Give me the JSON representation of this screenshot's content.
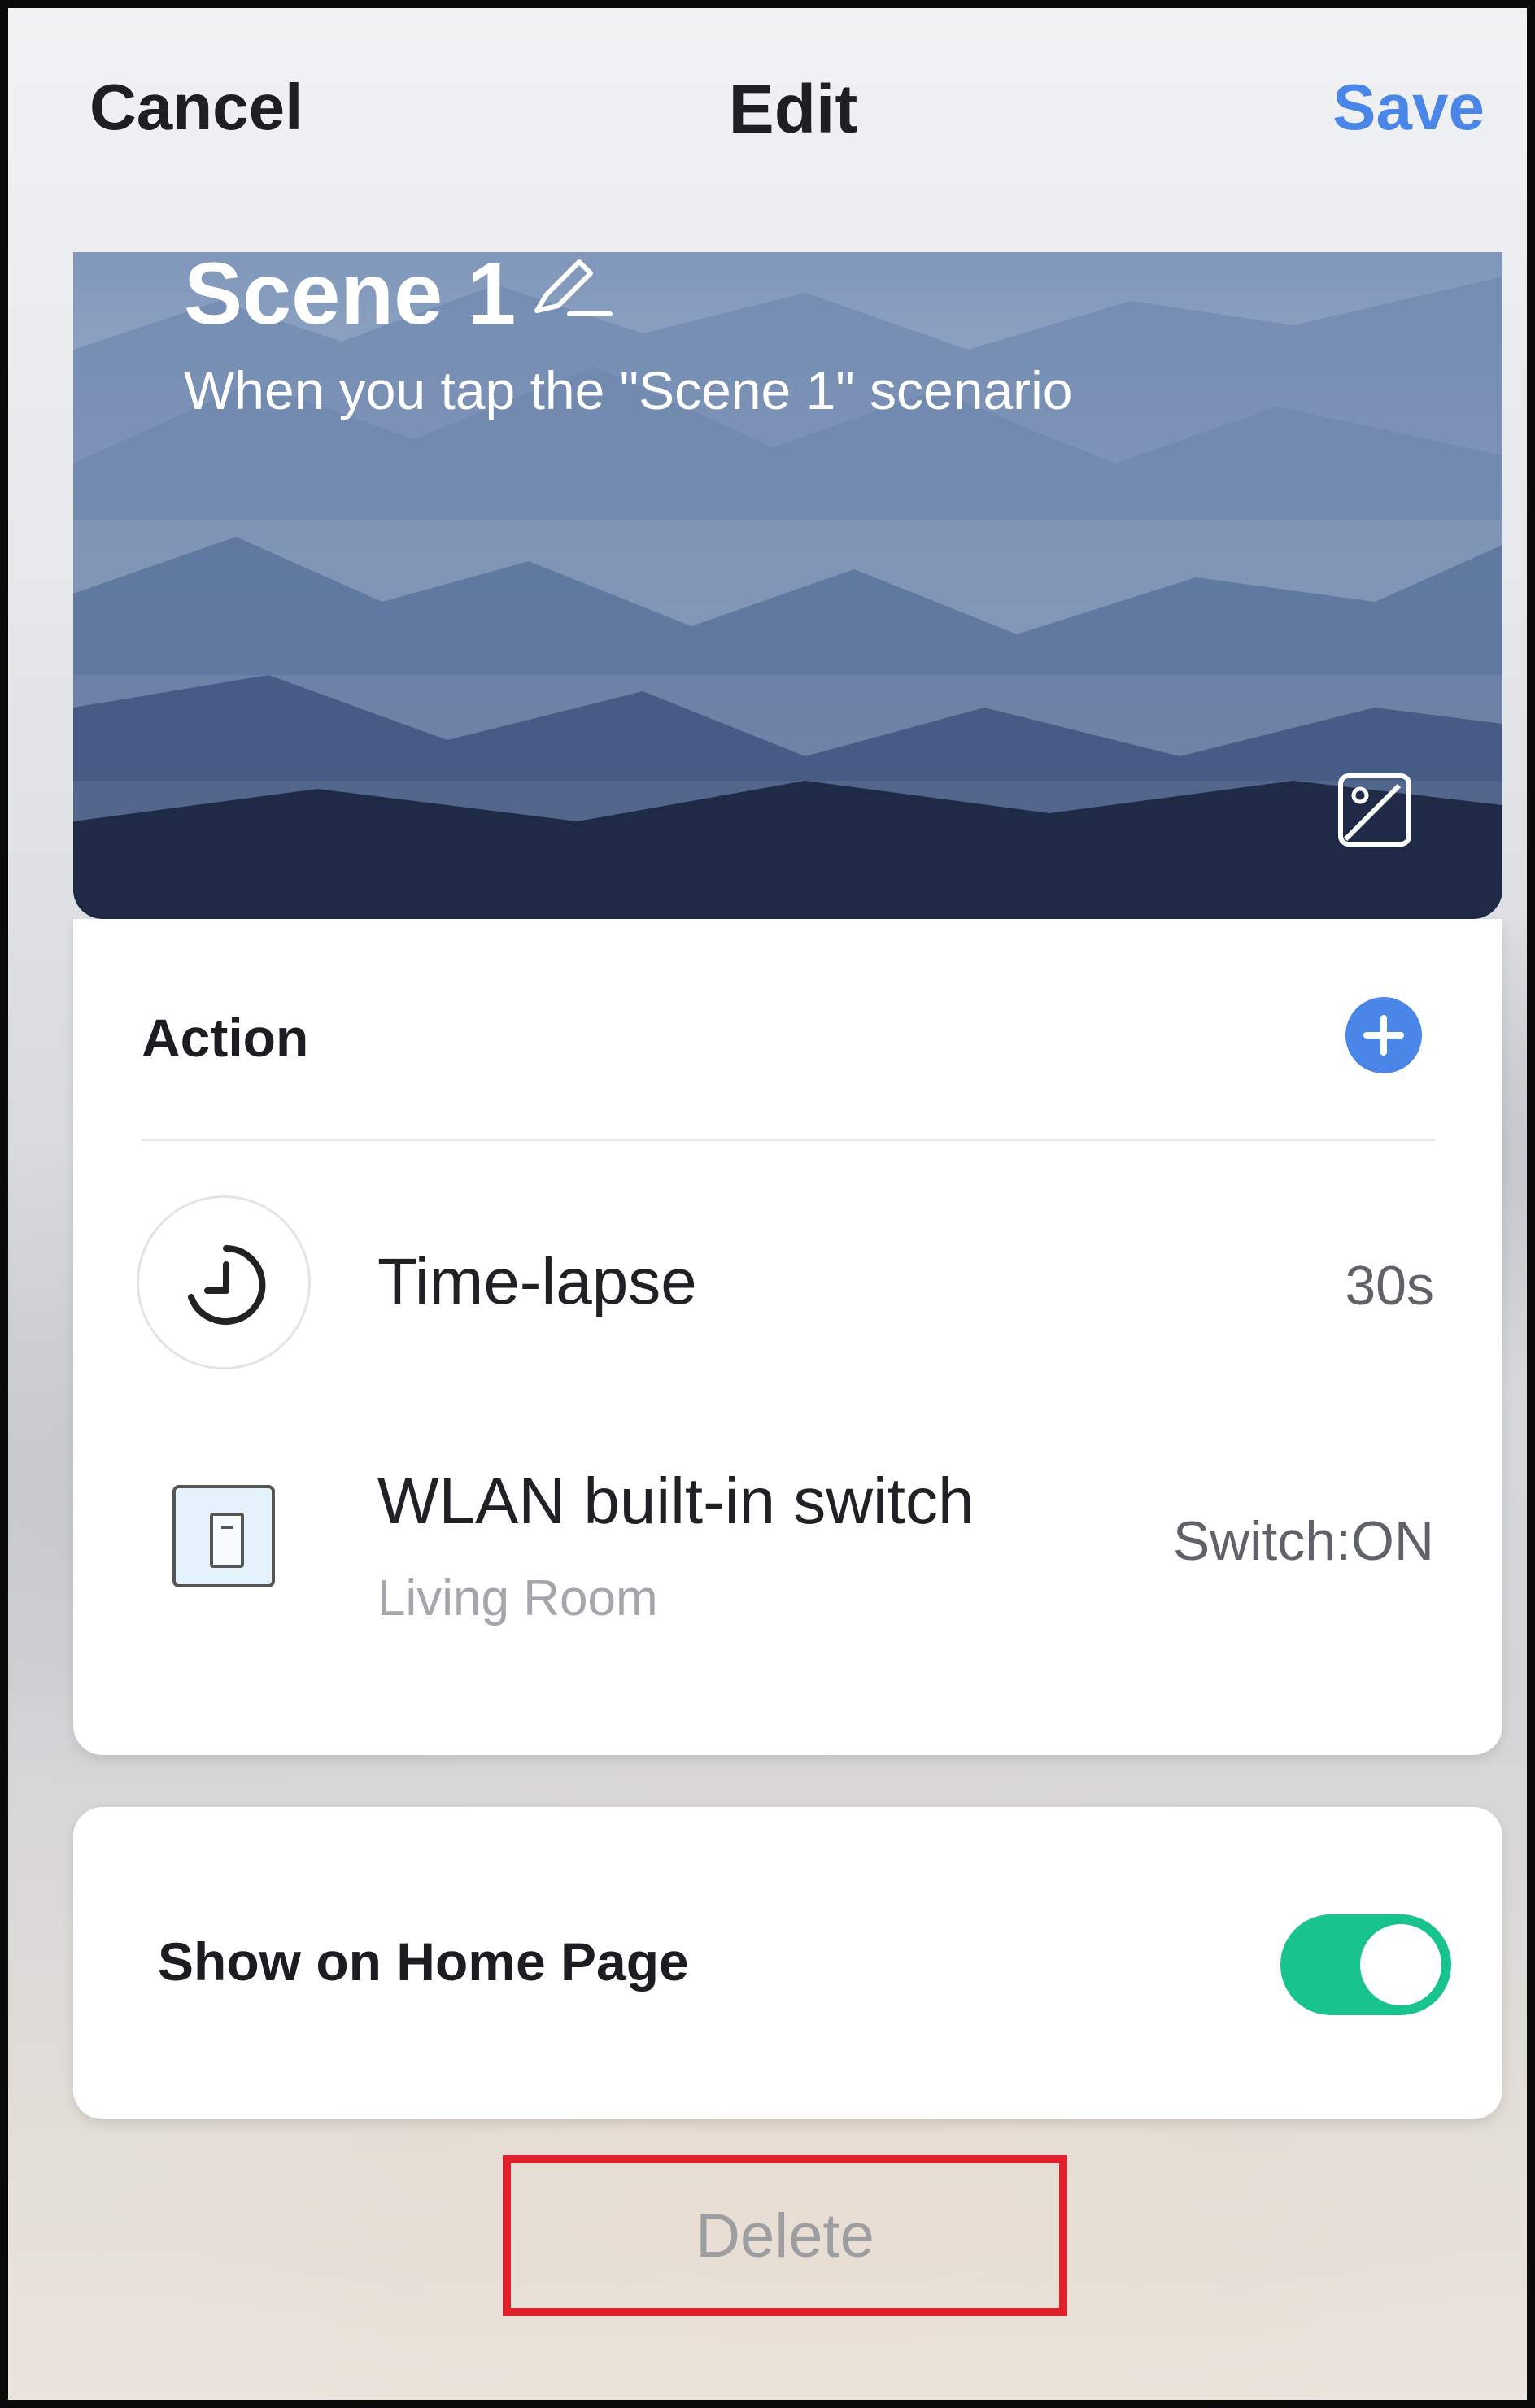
{
  "nav": {
    "cancel_label": "Cancel",
    "title": "Edit",
    "save_label": "Save"
  },
  "scene": {
    "name": "Scene 1",
    "subtitle": "When you tap the \"Scene 1\" scenario"
  },
  "actions": {
    "title": "Action",
    "items": [
      {
        "label": "Time-lapse",
        "value": "30s",
        "icon": "clock-icon"
      },
      {
        "label": "WLAN built-in switch",
        "sublabel": "Living Room",
        "value": "Switch:ON",
        "icon": "wall-switch-icon"
      }
    ]
  },
  "home": {
    "label": "Show on Home Page",
    "enabled": true
  },
  "delete_label": "Delete",
  "colors": {
    "accent": "#4a86e8",
    "toggle_on": "#19c38d",
    "highlight_box": "#e0202b"
  }
}
